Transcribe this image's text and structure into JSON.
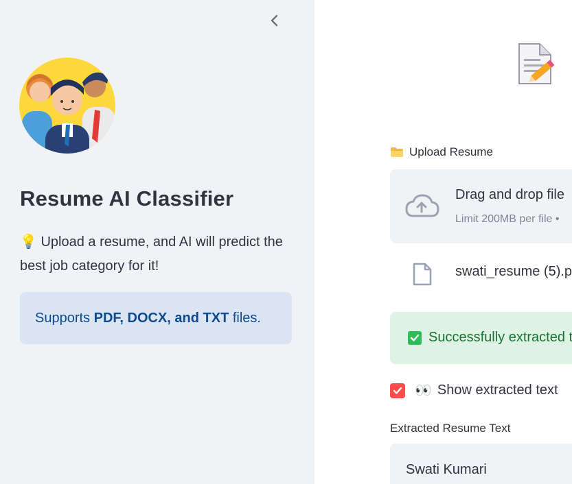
{
  "sidebar": {
    "title": "Resume AI Classifier",
    "description": "💡 Upload a resume, and AI will predict the best job category for it!",
    "info": {
      "prefix": "Supports ",
      "bold": "PDF, DOCX, and TXT",
      "suffix": " files."
    }
  },
  "main": {
    "upload": {
      "label": "Upload Resume",
      "drag_text": "Drag and drop file",
      "limit_text": "Limit 200MB per file •",
      "file_name": "swati_resume (5).p"
    },
    "success_message": "Successfully extracted t",
    "show_text_checkbox": {
      "label": "Show extracted text",
      "checked": true
    },
    "extracted": {
      "label": "Extracted Resume Text",
      "text": "Swati Kumari"
    }
  },
  "colors": {
    "sidebar_bg": "#f0f2f6",
    "info_bg": "#dbe5f2",
    "info_text": "#0e4a8f",
    "success_bg": "#dff3e5",
    "success_text": "#177233",
    "accent": "#ff4b4b"
  },
  "icons": {
    "collapse": "chevron-left-icon",
    "logo": "team-avatar-icon",
    "upload_folder": "folder-icon",
    "cloud": "cloud-upload-icon",
    "file": "file-icon",
    "check": "check-icon",
    "eyes": "eyes-emoji"
  }
}
